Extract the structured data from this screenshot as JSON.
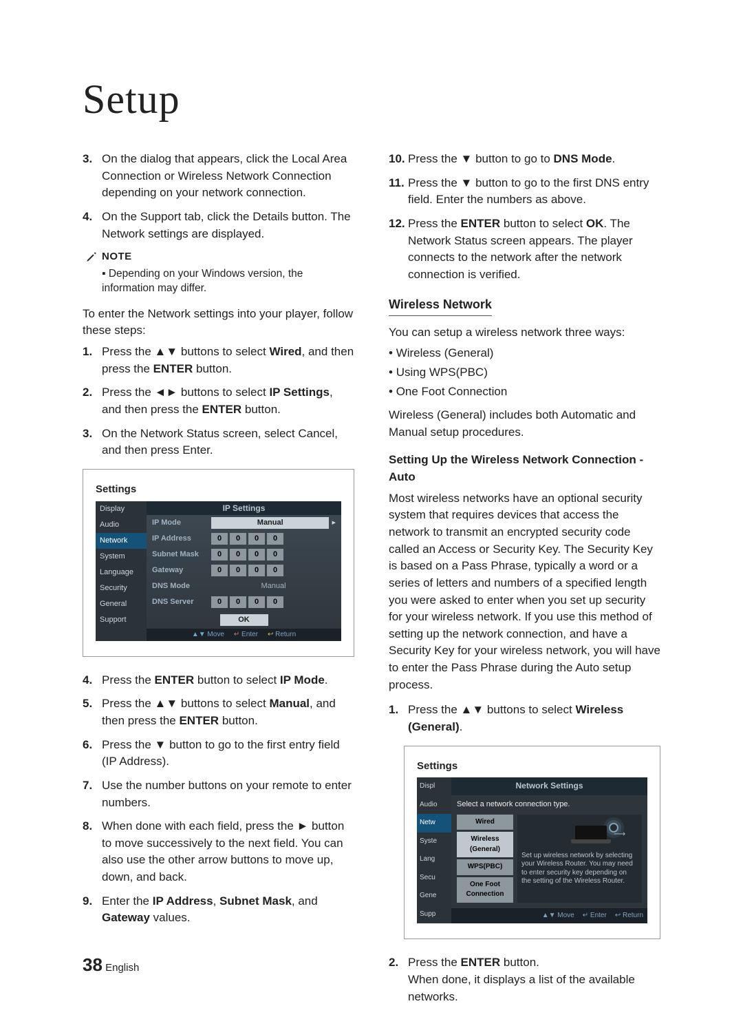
{
  "page_title": "Setup",
  "left": {
    "list_a": [
      {
        "n": "3.",
        "t": "On the dialog that appears, click the Local Area Connection or Wireless Network Connection depending on your network connection."
      },
      {
        "n": "4.",
        "t": "On the Support tab, click the Details button. The Network settings are displayed."
      }
    ],
    "note_label": "NOTE",
    "note_items": [
      "Depending on your Windows version, the information may differ."
    ],
    "intro": "To enter the Network settings into your player, follow these steps:",
    "list_b": [
      {
        "n": "1.",
        "pre": "Press the ",
        "arrows": "▲▼",
        "mid": " buttons to select ",
        "bold": "Wired",
        "post": ", and then press the ",
        "bold2": "ENTER",
        "post2": " button."
      },
      {
        "n": "2.",
        "pre": "Press the ",
        "arrows": "◄►",
        "mid": " buttons to select ",
        "bold": "IP Settings",
        "post": ", and then press the ",
        "bold2": "ENTER",
        "post2": " button."
      },
      {
        "n": "3.",
        "plain": "On the Network Status screen, select Cancel, and then press Enter."
      }
    ],
    "shot1": {
      "title": "Settings",
      "panel_title": "IP Settings",
      "side": [
        "Display",
        "Audio",
        "Network",
        "System",
        "Language",
        "Security",
        "General",
        "Support"
      ],
      "side_sel": "Network",
      "rows": {
        "ip_mode": {
          "lbl": "IP Mode",
          "val": "Manual",
          "chev": "▸"
        },
        "ip_addr": {
          "lbl": "IP Address",
          "oct": [
            "0",
            "0",
            "0",
            "0"
          ]
        },
        "subnet": {
          "lbl": "Subnet Mask",
          "oct": [
            "0",
            "0",
            "0",
            "0"
          ]
        },
        "gateway": {
          "lbl": "Gateway",
          "oct": [
            "0",
            "0",
            "0",
            "0"
          ]
        },
        "dns_mode": {
          "lbl": "DNS Mode",
          "val": "Manual"
        },
        "dns_srv": {
          "lbl": "DNS Server",
          "oct": [
            "0",
            "0",
            "0",
            "0"
          ]
        }
      },
      "ok": "OK",
      "hints": {
        "move": "Move",
        "enter": "Enter",
        "return": "Return",
        "moveicon": "▲▼",
        "entericon": "↵",
        "returnicon": "↩"
      }
    },
    "list_c": [
      {
        "n": "4.",
        "pre": "Press the ",
        "bold": "ENTER",
        "mid": " button to select ",
        "bold2": "IP Mode",
        "post": "."
      },
      {
        "n": "5.",
        "pre": "Press the ",
        "arrows": "▲▼",
        "mid": " buttons to select ",
        "bold": "Manual",
        "post": ", and then press the ",
        "bold2": "ENTER",
        "post2": " button."
      },
      {
        "n": "6.",
        "pre": "Press the ",
        "arrows": "▼",
        "mid": " button to go to the first entry field (IP Address)."
      },
      {
        "n": "7.",
        "plain": "Use the number buttons on your remote to enter numbers."
      },
      {
        "n": "8.",
        "pre": "When done with each field, press the ",
        "arrows": "►",
        "mid": " button to move successively to the next field. You can also use the other arrow buttons to move up, down, and back."
      },
      {
        "n": "9.",
        "pre": "Enter the ",
        "bold": "IP Address",
        "mid": ", ",
        "bold2": "Subnet Mask",
        "mid2": ", and ",
        "bold3": "Gateway",
        "post": " values."
      }
    ]
  },
  "right": {
    "list_top": [
      {
        "n": "10.",
        "pre": "Press the ",
        "arrows": "▼",
        "mid": " button to go to ",
        "bold": "DNS Mode",
        "post": "."
      },
      {
        "n": "11.",
        "pre": "Press the ",
        "arrows": "▼",
        "mid": " button to go to the first DNS entry field. Enter the numbers as above."
      },
      {
        "n": "12.",
        "pre": "Press the ",
        "bold": "ENTER",
        "mid": " button to select ",
        "bold2": "OK",
        "post": ". The Network Status screen appears. The player connects to the network after the network connection is verified."
      }
    ],
    "sec_title": "Wireless Network",
    "sec_intro": "You can setup a wireless network three ways:",
    "bullets": [
      "Wireless (General)",
      "Using WPS(PBC)",
      "One Foot Connection"
    ],
    "sec_note": "Wireless (General) includes both Automatic and Manual setup procedures.",
    "sub_heading": "Setting Up the Wireless Network Connection - Auto",
    "sub_para": "Most wireless networks have an optional security system that requires devices that access the network to transmit an encrypted security code called an Access or Security Key. The Security Key is based on a Pass Phrase, typically a word or a series of letters and numbers of a specified length you were asked to enter when you set up security for your wireless network. If you use this method of setting up the network connection, and have a Security Key for your wireless network, you will have to enter the Pass Phrase during the Auto setup process.",
    "list_r1": [
      {
        "n": "1.",
        "pre": "Press the ",
        "arrows": "▲▼",
        "mid": " buttons to select ",
        "bold": "Wireless (General)",
        "post": "."
      }
    ],
    "shot2": {
      "title": "Settings",
      "panel_title": "Network Settings",
      "sub": "Select a network connection type.",
      "side": [
        "Displ",
        "Audio",
        "Netw",
        "Syste",
        "Lang",
        "Secu",
        "Gene",
        "Supp"
      ],
      "side_sel": "Netw",
      "opts": [
        "Wired",
        "Wireless (General)",
        "WPS(PBC)",
        "One Foot Connection"
      ],
      "opt_sel": "Wireless (General)",
      "desc": "Set up wireless network by selecting your Wireless Router. You may need to enter security key depending on the setting of the Wireless Router.",
      "hints": {
        "move": "Move",
        "enter": "Enter",
        "return": "Return",
        "moveicon": "▲▼",
        "entericon": "↵",
        "returnicon": "↩"
      }
    },
    "list_r2": [
      {
        "n": "2.",
        "pre": "Press the ",
        "bold": "ENTER",
        "mid": " button.",
        "br": true,
        "post": "When done, it displays a list of the available networks."
      }
    ]
  },
  "footer": {
    "num": "38",
    "lang": "English"
  }
}
